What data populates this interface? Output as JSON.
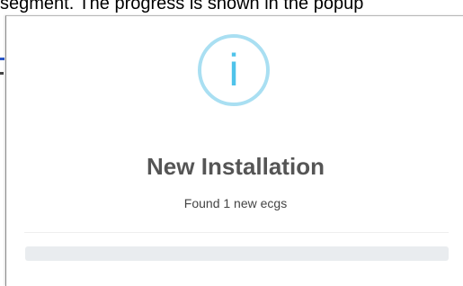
{
  "background": {
    "text": "segment. The progress is shown in the popup"
  },
  "dialog": {
    "icon": "info-icon",
    "icon_glyph": "i",
    "title": "New Installation",
    "message": "Found 1 new ecgs",
    "progress": 0
  },
  "colors": {
    "icon_ring": "#a9dff2",
    "icon_glyph": "#4fc3ea",
    "title": "#555555",
    "progress_track": "#e9ecef"
  }
}
